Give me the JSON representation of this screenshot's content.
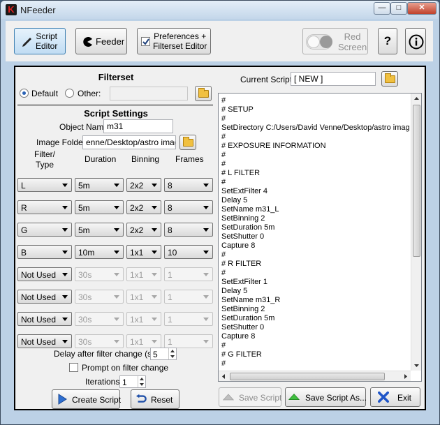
{
  "window": {
    "title": "NFeeder",
    "app_icon_glyph": "K",
    "min_glyph": "—",
    "max_glyph": "□",
    "close_glyph": "✕"
  },
  "toolbar": {
    "script_editor": {
      "line1": "Script",
      "line2": "Editor"
    },
    "feeder": "Feeder",
    "preferences": {
      "line1": "Preferences +",
      "line2": "Filterset Editor",
      "checked": true
    },
    "red_screen": {
      "line1": "Red",
      "line2": "Screen"
    },
    "help": "?"
  },
  "filterset": {
    "heading": "Filterset",
    "default_label": "Default",
    "other_label": "Other:",
    "other_value": "",
    "selected": "Default"
  },
  "script_settings": {
    "heading": "Script Settings",
    "object_name_label": "Object Name",
    "object_name": "m31",
    "image_folder_label": "Image Folder",
    "image_folder": "enne/Desktop/astro images",
    "columns": {
      "filter_type": "Filter/\nType",
      "duration": "Duration",
      "binning": "Binning",
      "frames": "Frames"
    },
    "rows": [
      {
        "filter": "L",
        "duration": "5m",
        "binning": "2x2",
        "frames": "8",
        "enabled": true
      },
      {
        "filter": "R",
        "duration": "5m",
        "binning": "2x2",
        "frames": "8",
        "enabled": true
      },
      {
        "filter": "G",
        "duration": "5m",
        "binning": "2x2",
        "frames": "8",
        "enabled": true
      },
      {
        "filter": "B",
        "duration": "10m",
        "binning": "1x1",
        "frames": "10",
        "enabled": true
      },
      {
        "filter": "Not Used",
        "duration": "30s",
        "binning": "1x1",
        "frames": "1",
        "enabled": false
      },
      {
        "filter": "Not Used",
        "duration": "30s",
        "binning": "1x1",
        "frames": "1",
        "enabled": false
      },
      {
        "filter": "Not Used",
        "duration": "30s",
        "binning": "1x1",
        "frames": "1",
        "enabled": false
      },
      {
        "filter": "Not Used",
        "duration": "30s",
        "binning": "1x1",
        "frames": "1",
        "enabled": false
      }
    ],
    "delay_label": "Delay after filter change (s)",
    "delay_value": "5",
    "prompt_label": "Prompt on filter change",
    "prompt_checked": false,
    "iterations_label": "Iterations",
    "iterations_value": "1",
    "create_script": "Create Script",
    "reset": "Reset"
  },
  "script": {
    "current_label": "Current Script",
    "current_value": "[ NEW ]",
    "lines": [
      "#",
      "# SETUP",
      "#",
      "SetDirectory C:/Users/David Venne/Desktop/astro images",
      "#",
      "# EXPOSURE INFORMATION",
      "#",
      "#",
      "# L FILTER",
      "#",
      "SetExtFilter 4",
      "Delay 5",
      "SetName m31_L",
      "SetBinning 2",
      "SetDuration 5m",
      "SetShutter 0",
      "Capture 8",
      "#",
      "# R FILTER",
      "#",
      "SetExtFilter 1",
      "Delay 5",
      "SetName m31_R",
      "SetBinning 2",
      "SetDuration 5m",
      "SetShutter 0",
      "Capture 8",
      "#",
      "# G FILTER",
      "#"
    ],
    "save_script": "Save Script",
    "save_script_as": "Save Script As...",
    "exit": "Exit"
  },
  "colors": {
    "window_frame": "#bcd1e6",
    "panel": "#f0f0f0",
    "accent_blue": "#2a62b5",
    "close_red": "#c0402a"
  }
}
